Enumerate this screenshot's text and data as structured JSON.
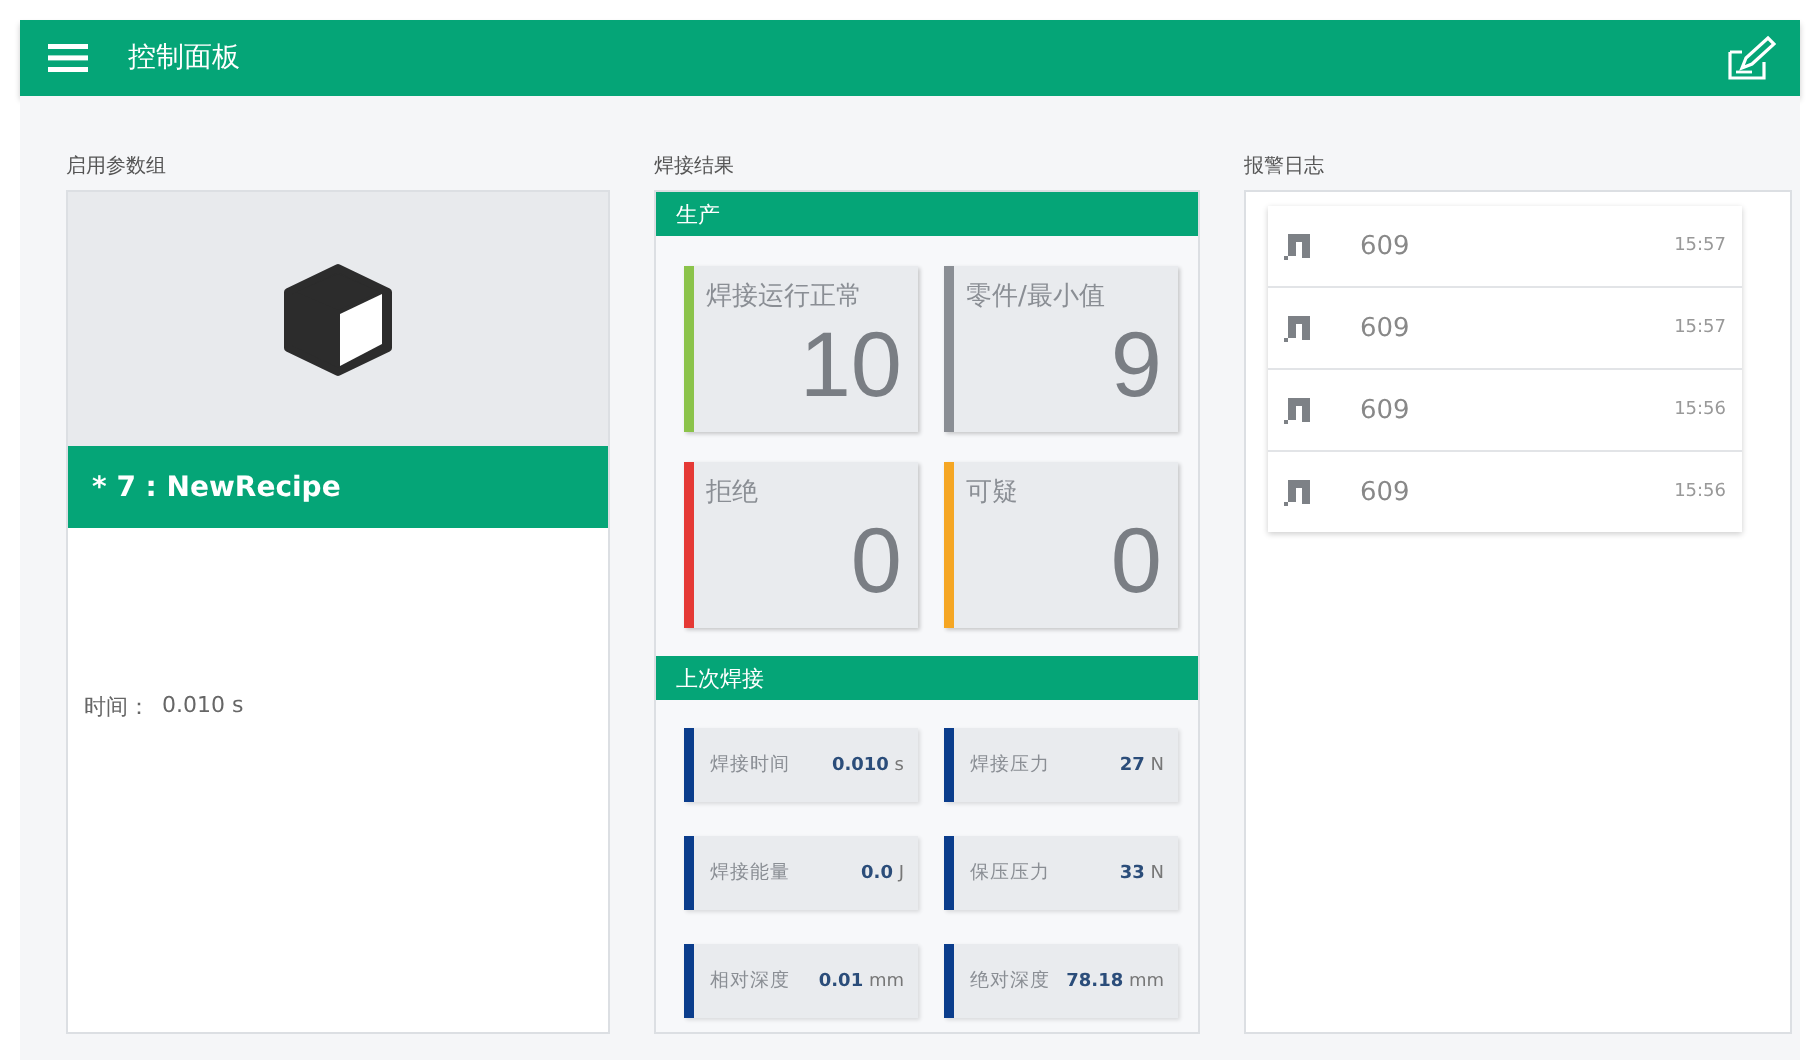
{
  "header": {
    "title": "控制面板"
  },
  "recipe_panel": {
    "title": "启用参数组",
    "recipe_name": "* 7 : NewRecipe",
    "time_label": "时间：",
    "time_value": "0.010 s"
  },
  "weld_results": {
    "title": "焊接结果",
    "production": {
      "title": "生产",
      "tiles": [
        {
          "label": "焊接运行正常",
          "value": "10",
          "color": "#8bc34a"
        },
        {
          "label": "零件/最小值",
          "value": "9",
          "color": "#8a8e94"
        },
        {
          "label": "拒绝",
          "value": "0",
          "color": "#e53935"
        },
        {
          "label": "可疑",
          "value": "0",
          "color": "#f5a623"
        }
      ]
    },
    "last_weld": {
      "title": "上次焊接",
      "items": [
        {
          "label": "焊接时间",
          "value": "**0.010** s"
        },
        {
          "label": "焊接压力",
          "value": "**27** N"
        },
        {
          "label": "焊接能量",
          "value": "**0.0** J"
        },
        {
          "label": "保压压力",
          "value": "**33** N"
        },
        {
          "label": "相对深度",
          "value": "**0.01** mm"
        },
        {
          "label": "绝对深度",
          "value": "**78.18** mm"
        }
      ]
    }
  },
  "alarm_log": {
    "title": "报警日志",
    "entries": [
      {
        "code": "609",
        "time": "15:57"
      },
      {
        "code": "609",
        "time": "15:57"
      },
      {
        "code": "609",
        "time": "15:56"
      },
      {
        "code": "609",
        "time": "15:56"
      }
    ]
  }
}
